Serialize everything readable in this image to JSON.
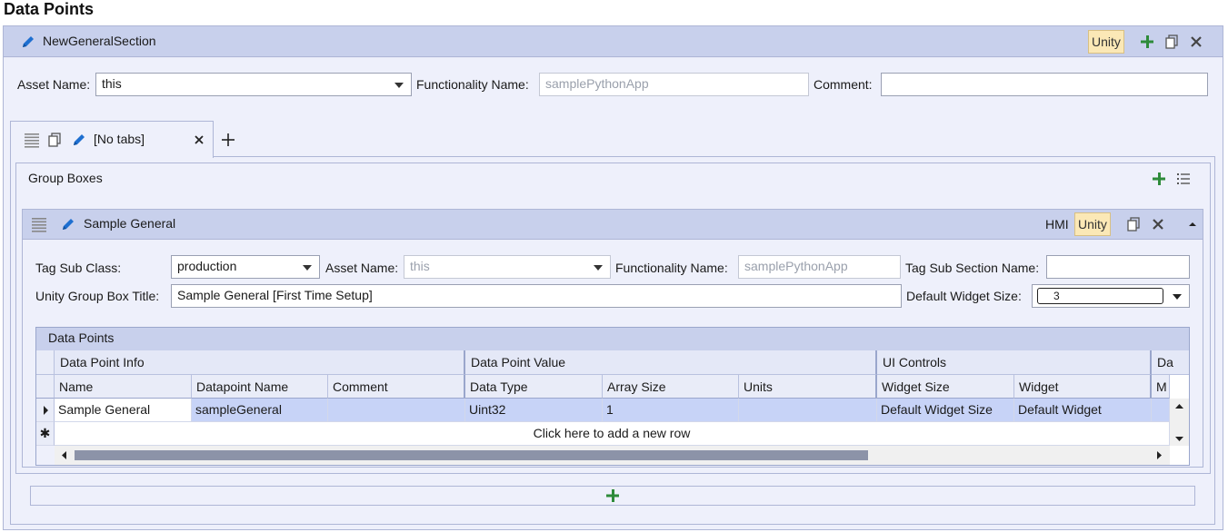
{
  "page": {
    "title": "Data Points"
  },
  "section": {
    "name": "NewGeneralSection",
    "unity_badge": "Unity",
    "asset_name_label": "Asset Name:",
    "asset_name_value": "this",
    "functionality_name_label": "Functionality Name:",
    "functionality_name_value": "samplePythonApp",
    "comment_label": "Comment:",
    "comment_value": ""
  },
  "tabs": [
    {
      "label": "[No tabs]"
    }
  ],
  "group_boxes": {
    "title": "Group Boxes",
    "box": {
      "name": "Sample General",
      "hmi_label": "HMI",
      "unity_badge": "Unity",
      "tag_sub_class_label": "Tag Sub Class:",
      "tag_sub_class_value": "production",
      "asset_name_label": "Asset Name:",
      "asset_name_value": "this",
      "functionality_name_label": "Functionality Name:",
      "functionality_name_value": "samplePythonApp",
      "tag_sub_section_label": "Tag Sub Section Name:",
      "tag_sub_section_value": "",
      "unity_title_label": "Unity Group Box Title:",
      "unity_title_value": "Sample General [First Time Setup]",
      "default_widget_size_label": "Default Widget Size:",
      "default_widget_size_value": "3"
    }
  },
  "grid": {
    "title": "Data Points",
    "bands": [
      "Data Point Info",
      "Data Point Value",
      "UI Controls",
      "Da"
    ],
    "columns": [
      "Name",
      "Datapoint Name",
      "Comment",
      "Data Type",
      "Array Size",
      "Units",
      "Widget Size",
      "Widget",
      "M"
    ],
    "rows": [
      [
        "Sample General",
        "sampleGeneral",
        "",
        "Uint32",
        "1",
        "",
        "Default Widget Size",
        "Default Widget",
        ""
      ]
    ],
    "new_row_text": "Click here to add a new row"
  },
  "colors": {
    "header_bg": "#c8d0ec",
    "body_bg": "#eef0fb",
    "unity_badge_bg": "#fbe8b6",
    "add_green": "#2e8b3a",
    "edit_blue": "#1e6fd0",
    "selected_row": "#c7d3f7"
  }
}
